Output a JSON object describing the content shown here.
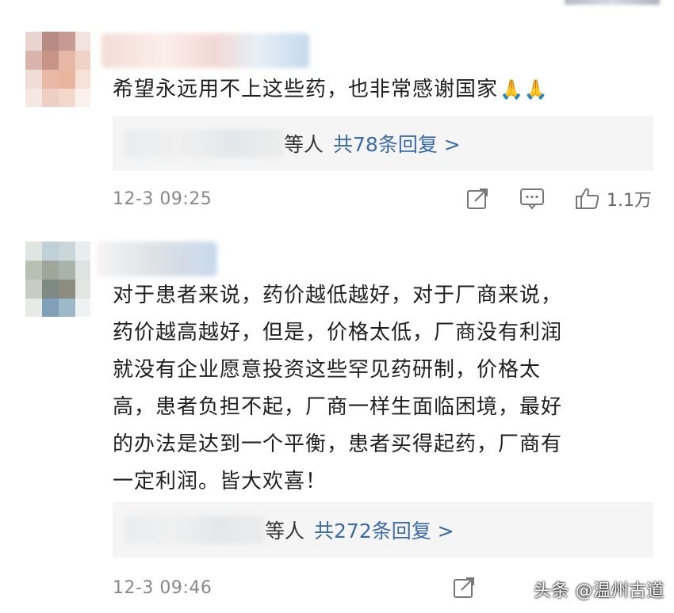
{
  "comments": [
    {
      "text": "希望永远用不上这些药，也非常感谢国家",
      "emoji": "🙏🙏",
      "reply_suffix": "等人",
      "reply_link": "共78条回复 >",
      "time": "12-3 09:25",
      "like_count": "1.1万"
    },
    {
      "text_lines": [
        "对于患者来说，药价越低越好，对于厂商来说，",
        "药价越高越好，但是，价格太低，厂商没有利润",
        "就没有企业愿意投资这些罕见药研制，价格太",
        "高，患者负担不起，厂商一样生面临困境，最好",
        "的办法是达到一个平衡，患者买得起药，厂商有",
        "一定利润。皆大欢喜！"
      ],
      "reply_suffix": "等人",
      "reply_link": "共272条回复 >",
      "time": "12-3 09:46"
    }
  ],
  "watermark": "头条 @温州古道",
  "icons": {
    "share": "share-icon",
    "comment": "comment-icon",
    "like": "thumbs-up-icon"
  },
  "colors": {
    "link": "#3b6aa8",
    "time": "#888888",
    "reply_bg": "#f5f5f5"
  }
}
